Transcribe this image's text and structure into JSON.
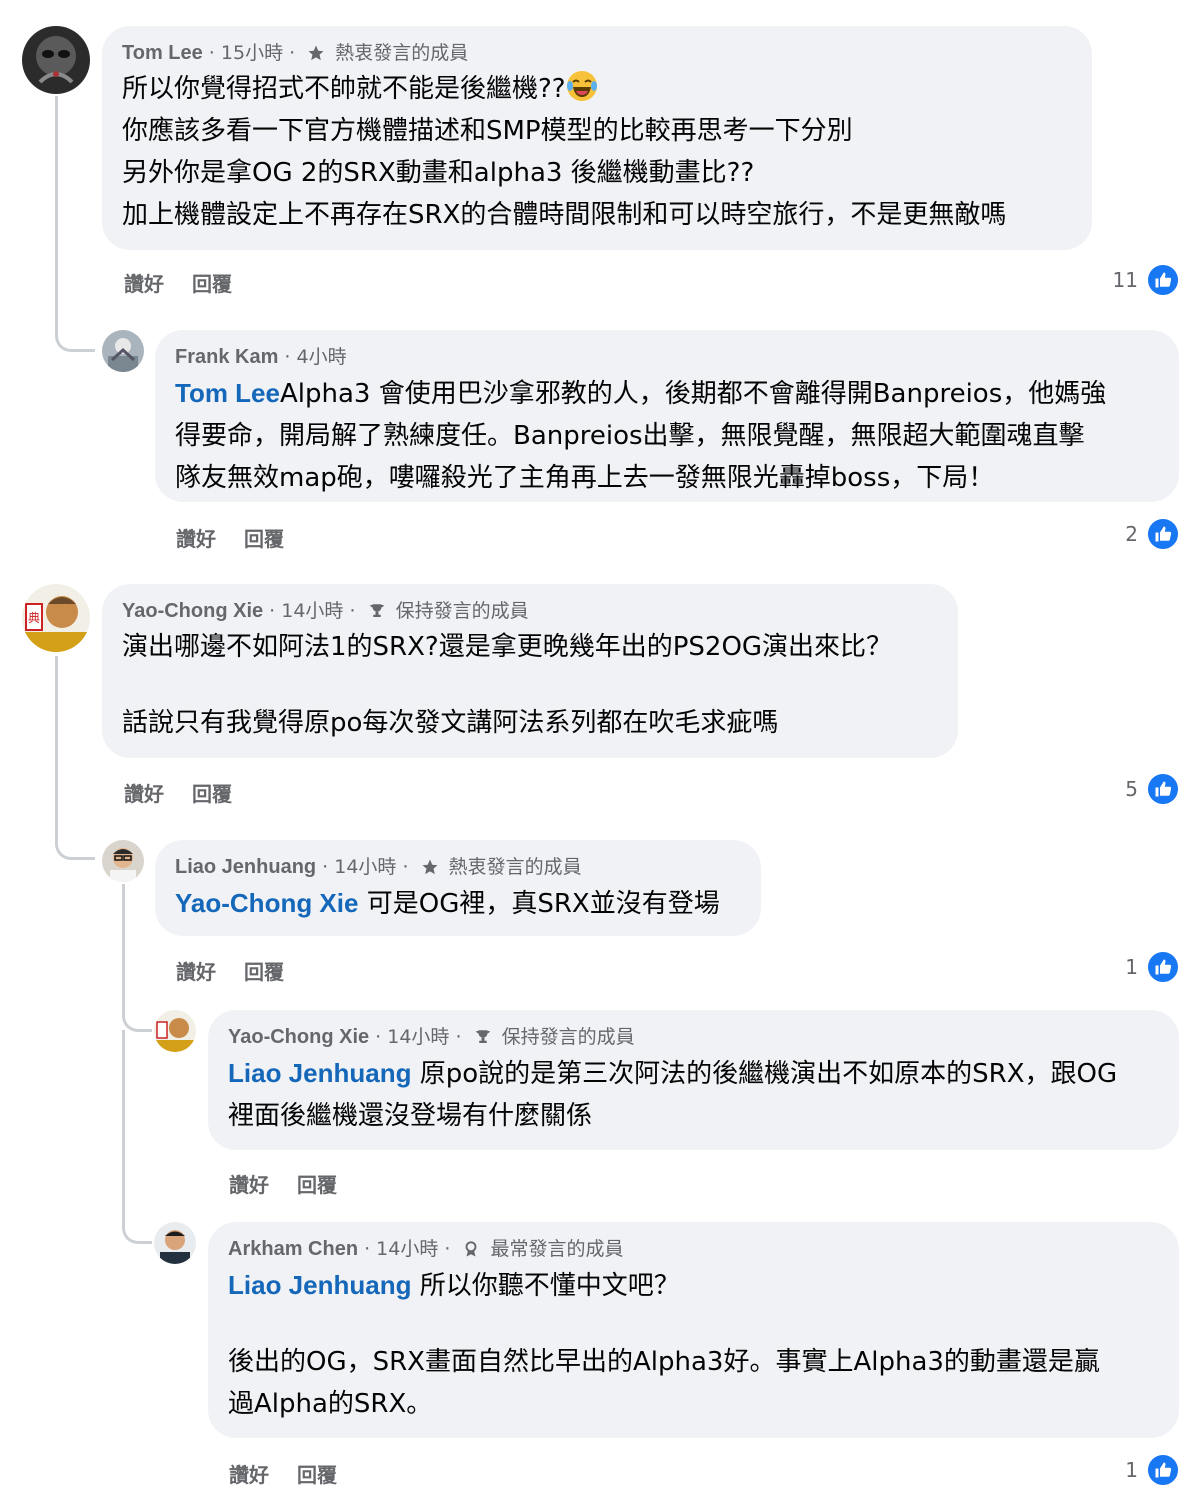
{
  "actions": {
    "like": "讚好",
    "reply": "回覆"
  },
  "comments": [
    {
      "author": "Tom Lee",
      "time": "15小時",
      "badge": "熱衷發言的成員",
      "badge_icon": "star-icon",
      "lines": [
        "所以你覺得招式不帥就不能是後繼機??",
        "你應該多看一下官方機體描述和SMP模型的比較再思考一下分別",
        "另外你是拿OG 2的SRX動畫和alpha3 後繼機動畫比??",
        "加上機體設定上不再存在SRX的合體時間限制和可以時空旅行，不是更無敵嗎"
      ],
      "emoji": "laughing-crying-emoji",
      "reactions": "11"
    },
    {
      "author": "Frank Kam",
      "time": "4小時",
      "mention": "Tom Lee",
      "lines": [
        "Alpha3 會使用巴沙拿邪教的人，後期都不會離得開Banpreios，他媽強",
        "得要命，開局解了熟練度任。Banpreios出擊，無限覺醒，無限超大範圍魂直擊",
        "隊友無效map砲，嘍囉殺光了主角再上去一發無限光轟掉boss，下局！"
      ],
      "reactions": "2"
    },
    {
      "author": "Yao-Chong Xie",
      "time": "14小時",
      "badge": "保持發言的成員",
      "badge_icon": "trophy-icon",
      "lines": [
        "演出哪邊不如阿法1的SRX?還是拿更晚幾年出的PS2OG演出來比？",
        "",
        "話說只有我覺得原po每次發文講阿法系列都在吹毛求疵嗎"
      ],
      "reactions": "5"
    },
    {
      "author": "Liao Jenhuang",
      "time": "14小時",
      "badge": "熱衷發言的成員",
      "badge_icon": "star-icon",
      "mention": "Yao-Chong Xie",
      "lines": [
        " 可是OG裡，真SRX並沒有登場"
      ],
      "reactions": "1"
    },
    {
      "author": "Yao-Chong Xie",
      "time": "14小時",
      "badge": "保持發言的成員",
      "badge_icon": "trophy-icon",
      "mention": "Liao Jenhuang",
      "lines": [
        " 原po說的是第三次阿法的後繼機演出不如原本的SRX，跟OG",
        "裡面後繼機還沒登場有什麼關係"
      ]
    },
    {
      "author": "Arkham Chen",
      "time": "14小時",
      "badge": "最常發言的成員",
      "badge_icon": "medal-icon",
      "mention": "Liao Jenhuang",
      "lines": [
        " 所以你聽不懂中文吧？",
        "",
        "後出的OG，SRX畫面自然比早出的Alpha3好。事實上Alpha3的動畫還是贏",
        "過Alpha的SRX。"
      ],
      "reactions": "1"
    }
  ],
  "colors": {
    "bubble": "#f0f2f5",
    "mention": "#1467b9",
    "like": "#1877f2",
    "muted": "#65676b"
  }
}
